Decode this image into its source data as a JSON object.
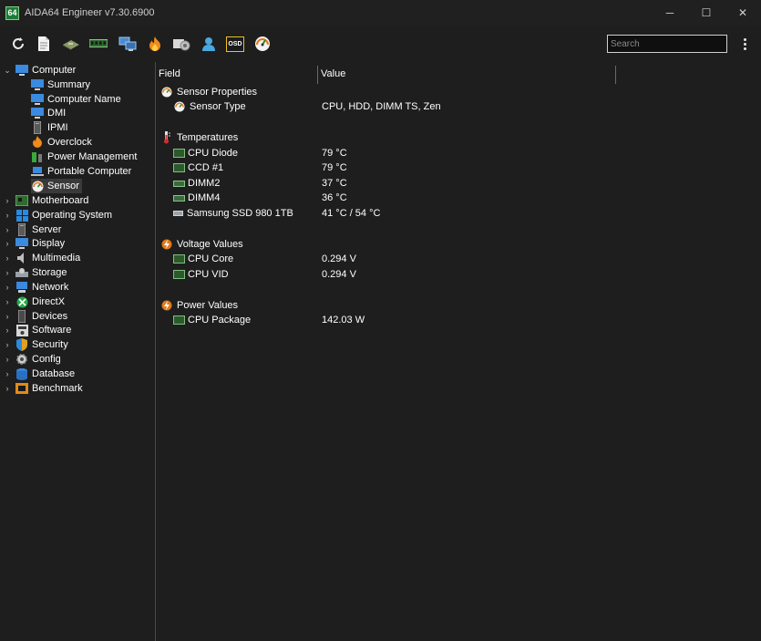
{
  "window": {
    "title": "AIDA64 Engineer v7.30.6900",
    "logo_text": "64",
    "minimize": "─",
    "maximize": "☐",
    "close": "✕"
  },
  "toolbar": {
    "icons": [
      "refresh-icon",
      "report-icon",
      "motherboard-icon",
      "memory-icon",
      "network-icon",
      "overclock-icon",
      "preferences-icon",
      "user-icon",
      "osd-icon",
      "sensor-icon"
    ],
    "osd_label": "OSD",
    "search_placeholder": "Search"
  },
  "tree": {
    "root": {
      "label": "Computer",
      "expanded": true
    },
    "computer_children": [
      {
        "label": "Summary",
        "icon": "monitor-icon"
      },
      {
        "label": "Computer Name",
        "icon": "monitor-icon"
      },
      {
        "label": "DMI",
        "icon": "monitor-icon"
      },
      {
        "label": "IPMI",
        "icon": "server-icon"
      },
      {
        "label": "Overclock",
        "icon": "flame-icon"
      },
      {
        "label": "Power Management",
        "icon": "battery-icon"
      },
      {
        "label": "Portable Computer",
        "icon": "laptop-icon"
      },
      {
        "label": "Sensor",
        "icon": "gauge-icon",
        "selected": true
      }
    ],
    "sections": [
      {
        "label": "Motherboard",
        "icon": "motherboard-icon"
      },
      {
        "label": "Operating System",
        "icon": "windows-icon"
      },
      {
        "label": "Server",
        "icon": "server-icon"
      },
      {
        "label": "Display",
        "icon": "display-icon"
      },
      {
        "label": "Multimedia",
        "icon": "speaker-icon"
      },
      {
        "label": "Storage",
        "icon": "storage-icon"
      },
      {
        "label": "Network",
        "icon": "network-icon"
      },
      {
        "label": "DirectX",
        "icon": "xbox-icon"
      },
      {
        "label": "Devices",
        "icon": "device-icon"
      },
      {
        "label": "Software",
        "icon": "software-icon"
      },
      {
        "label": "Security",
        "icon": "shield-icon"
      },
      {
        "label": "Config",
        "icon": "config-icon"
      },
      {
        "label": "Database",
        "icon": "database-icon"
      },
      {
        "label": "Benchmark",
        "icon": "benchmark-icon"
      }
    ]
  },
  "table": {
    "col_field": "Field",
    "col_value": "Value",
    "groups": [
      {
        "title": "Sensor Properties",
        "icon": "gauge-icon",
        "rows": [
          {
            "field": "Sensor Type",
            "value": "CPU, HDD, DIMM TS, Zen",
            "icon": "gauge-icon"
          }
        ]
      },
      {
        "title": "Temperatures",
        "icon": "thermometer-icon",
        "rows": [
          {
            "field": "CPU Diode",
            "value": "79 °C",
            "icon": "cpu-chip-icon"
          },
          {
            "field": "CCD #1",
            "value": "79 °C",
            "icon": "cpu-chip-icon"
          },
          {
            "field": "DIMM2",
            "value": "37 °C",
            "icon": "ram-icon"
          },
          {
            "field": "DIMM4",
            "value": "36 °C",
            "icon": "ram-icon"
          },
          {
            "field": "Samsung SSD 980 1TB",
            "value": "41 °C / 54 °C",
            "icon": "ssd-icon"
          }
        ]
      },
      {
        "title": "Voltage Values",
        "icon": "voltage-icon",
        "rows": [
          {
            "field": "CPU Core",
            "value": "0.294 V",
            "icon": "cpu-chip-icon"
          },
          {
            "field": "CPU VID",
            "value": "0.294 V",
            "icon": "cpu-chip-icon"
          }
        ]
      },
      {
        "title": "Power Values",
        "icon": "power-icon",
        "rows": [
          {
            "field": "CPU Package",
            "value": "142.03 W",
            "icon": "cpu-chip-icon"
          }
        ]
      }
    ]
  }
}
